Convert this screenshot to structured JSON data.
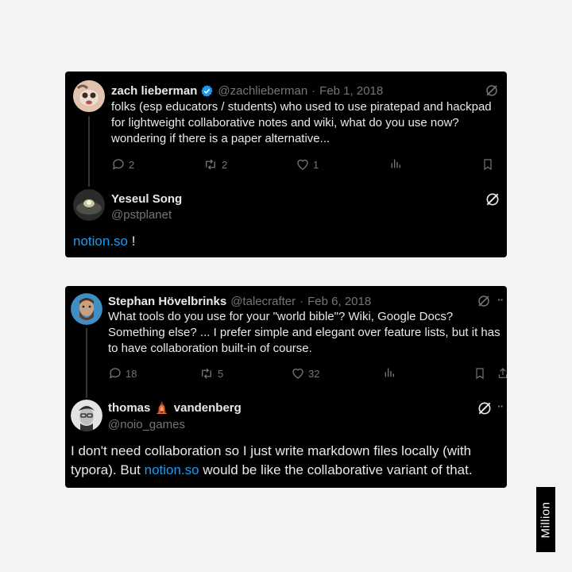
{
  "thread1": {
    "tweet": {
      "name": "zach lieberman",
      "handle": "@zachlieberman",
      "separator": "·",
      "date": "Feb 1, 2018",
      "verified": true,
      "text": "folks (esp educators / students) who used to use piratepad and hackpad for lightweight collaborative notes and wiki, what do you use now? wondering if there is a paper alternative...",
      "replies": "2",
      "retweets": "2",
      "likes": "1"
    },
    "reply": {
      "name": "Yeseul Song",
      "handle": "@pstplanet",
      "link_text": "notion.so",
      "text_after": " !"
    }
  },
  "thread2": {
    "tweet": {
      "name": "Stephan Hövelbrinks",
      "handle": "@talecrafter",
      "separator": "·",
      "date": "Feb 6, 2018",
      "text": "What tools do you use for your \"world bible\"? Wiki, Google Docs? Something else? ... I prefer simple and elegant over feature lists, but it has to have collaboration built-in of course.",
      "replies": "18",
      "retweets": "5",
      "likes": "32",
      "more": "··"
    },
    "reply": {
      "name_first": "thomas",
      "name_emoji": "🛕",
      "name_last": "vandenberg",
      "handle": "@noio_games",
      "text_before": "I don't need collaboration so I just write markdown files locally (with typora). But ",
      "link_text": "notion.so",
      "text_after": " would be like the collaborative variant of that.",
      "more": "··"
    }
  },
  "brand": {
    "label": "Million"
  },
  "icons": {
    "reply": "speech-bubble-icon",
    "retweet": "retweet-icon",
    "like": "heart-icon",
    "views": "bar-chart-icon",
    "bookmark": "bookmark-icon",
    "share": "share-icon",
    "grok": "grok-slash-icon",
    "verified": "verified-badge-icon"
  },
  "colors": {
    "background": "#f4f3f1",
    "card": "#000000",
    "text": "#e7e9ea",
    "muted": "#71767b",
    "link": "#1d9bf0"
  }
}
